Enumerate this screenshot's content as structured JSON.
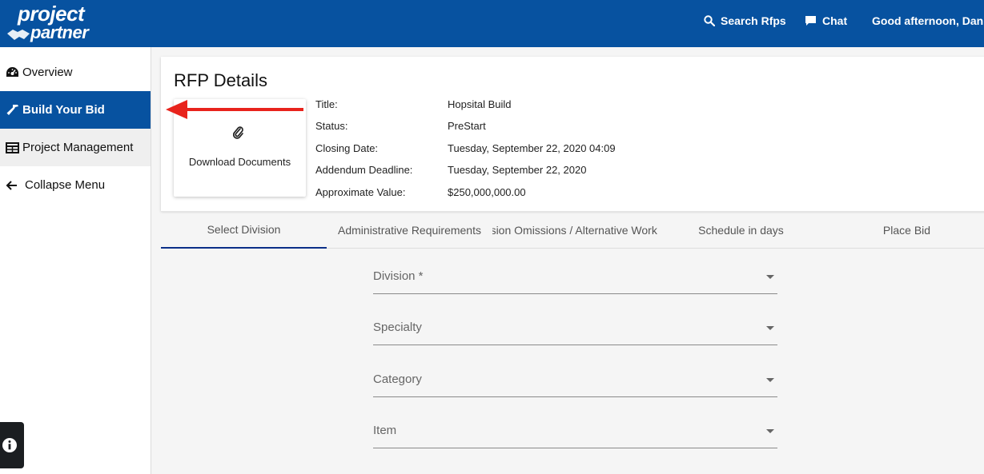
{
  "header": {
    "logo_line1": "project",
    "logo_line2": "partner",
    "search_label": "Search Rfps",
    "chat_label": "Chat",
    "greeting": "Good afternoon, Dan"
  },
  "sidebar": {
    "items": [
      {
        "label": "Overview",
        "icon": "dashboard-icon"
      },
      {
        "label": "Build Your Bid",
        "icon": "hammer-icon",
        "active": true
      },
      {
        "label": "Project Management",
        "icon": "table-icon"
      },
      {
        "label": "Collapse Menu",
        "icon": "arrow-left-icon"
      }
    ]
  },
  "rfp": {
    "title": "RFP Details",
    "download_label": "Download Documents",
    "fields": [
      {
        "label": "Title:",
        "value": "Hopsital Build"
      },
      {
        "label": "Status:",
        "value": "PreStart"
      },
      {
        "label": "Closing Date:",
        "value": "Tuesday, September 22, 2020 04:09"
      },
      {
        "label": "Addendum Deadline:",
        "value": "Tuesday, September 22, 2020"
      },
      {
        "label": "Approximate Value:",
        "value": "$250,000,000.00"
      }
    ]
  },
  "tabs": [
    "Select Division",
    "Administrative Requirements",
    "Inclusion Omissions / Alternative Work",
    "Schedule in days",
    "Place Bid"
  ],
  "form": {
    "fields": [
      "Division *",
      "Specialty",
      "Category",
      "Item"
    ]
  },
  "colors": {
    "brand": "#0752a0",
    "annotation_arrow": "#e8231c"
  }
}
